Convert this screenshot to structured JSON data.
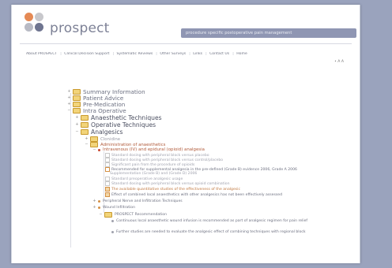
{
  "app": {
    "logo": "prospect",
    "tagline": "procedure specific postoperative pain management"
  },
  "nav": {
    "items": [
      "About PROSPECT",
      "Clinical Decision Support",
      "Systematic Reviews",
      "Other Surveys",
      "Links",
      "Contact Us",
      "Home"
    ],
    "extra": "• A   A"
  },
  "tree": {
    "level1": [
      "Summary Information",
      "Patient Advice",
      "Pre-Medication",
      "Intra Operative"
    ],
    "level2": [
      "Anaesthetic Techniques",
      "Operative Techniques",
      "Analgesics"
    ],
    "analgesics_children": [
      "Clonidine",
      "Administration of anaesthetics"
    ],
    "sub_item": "Intravenous (IV) and epidural (opioid) analgesia",
    "leaf_items": [
      "Standard dosing with peripheral block versus placebo",
      "Standard dosing with peripheral block versus control/placebo",
      "Significant pain from the procedure of opioids",
      "Recommended for supplemental analgesia in the pre-defined (Grade B) evidence 2006, Grade A 2006",
      "Supplementation (Grade B) and (Grade D) 2006",
      "Standard preoperative analgesic usage",
      "Standard dosing with peripheral block versus opioid combination",
      "The available quantitative studies of the effectiveness of the analgesic",
      "Effect of combined local anaesthetics with other analgesics has not been effectively assessed"
    ],
    "peripheral": "Peripheral Nerve and Infiltration Techniques",
    "block_sub": "Wound Infiltration",
    "prospect_label": "PROSPECT Recommendation",
    "recs": [
      "Continuous local anaesthetic wound infusion is recommended as part of analgesic regimen for pain relief",
      "Further studies are needed to evaluate the analgesic effect of combining techniques with regional block"
    ]
  }
}
